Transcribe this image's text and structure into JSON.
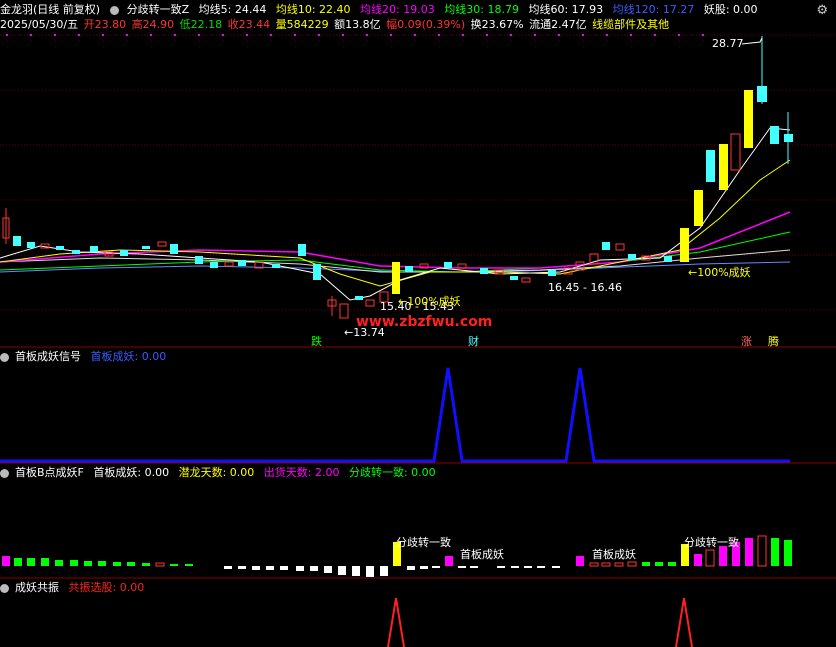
{
  "header": {
    "stock_name": "金龙羽(日线 前复权)",
    "indicator": "分歧转一致Z",
    "ma5": "均线5: 24.44",
    "ma10": "均线10: 22.40",
    "ma20": "均线20: 19.03",
    "ma30": "均线30: 18.79",
    "ma60": "均线60: 17.93",
    "ma120": "均线120: 17.27",
    "yaogu": "妖股: 0.00",
    "date": "2025/05/30/五",
    "open": "开23.80",
    "high": "高24.90",
    "low": "低22.18",
    "close": "收23.44",
    "volume": "量584229",
    "amount": "额13.8亿",
    "change": "幅0.09(0.39%)",
    "turnover": "换23.67%",
    "float": "流通2.47亿",
    "sector": "线缆部件及其他"
  },
  "main_chart": {
    "high_label": "28.77",
    "low_label": "←13.74",
    "range1": "15.40 - 15.43",
    "range2": "16.45 - 16.46",
    "pct1": "←100%成妖",
    "pct2": "←100%成妖",
    "watermark": "www.zbzfwu.com",
    "bottom_marks": {
      "die": "跌",
      "cai": "财",
      "zhang": "涨",
      "teng": "腾"
    }
  },
  "panel1": {
    "title": "首板成妖信号",
    "label": "首板成妖: 0.00"
  },
  "panel2": {
    "title": "首板B点成妖F",
    "item1": "首板成妖: 0.00",
    "item2": "潜龙天数: 0.00",
    "item3": "出货天数: 2.00",
    "item4": "分歧转一致: 0.00",
    "ann1": "分歧转一致",
    "ann2": "首板成妖",
    "ann3": "首板成妖",
    "ann4": "分歧转一致"
  },
  "panel3": {
    "title": "成妖共振",
    "label": "共振选股: 0.00"
  },
  "colors": {
    "ma5": "#ffffff",
    "ma10": "#ffff00",
    "ma20": "#ff00ff",
    "ma30": "#00ff00",
    "ma60": "#ffffff",
    "ma120": "#0000ff"
  }
}
